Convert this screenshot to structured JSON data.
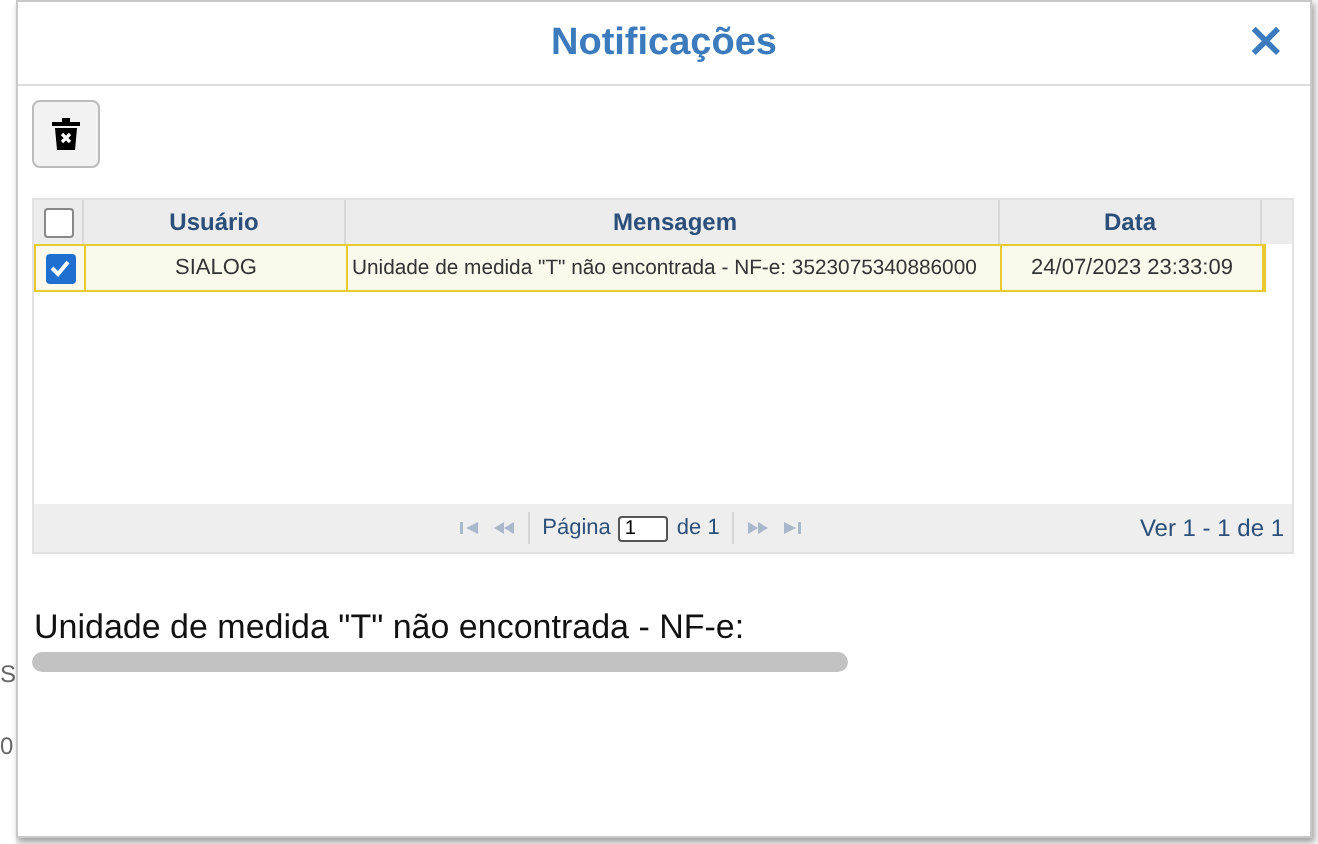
{
  "background": {
    "fragments": [
      "S",
      "0"
    ]
  },
  "dialog": {
    "title": "Notificações",
    "close": "×"
  },
  "table": {
    "select_all": {
      "checked": false
    },
    "columns": [
      "Usuário",
      "Mensagem",
      "Data"
    ],
    "rows": [
      {
        "selected": true,
        "cells": [
          "SIALOG",
          "Unidade de medida \"T\" não encontrada - NF-e: 3523075340886000",
          "24/07/2023 23:33:09"
        ]
      }
    ]
  },
  "pager": {
    "page_label": "Página",
    "page": "1",
    "of": "de 1",
    "summary": "Ver 1 - 1 de 1"
  },
  "detail": {
    "text": "Unidade de medida \"T\" não encontrada - NF-e:"
  }
}
